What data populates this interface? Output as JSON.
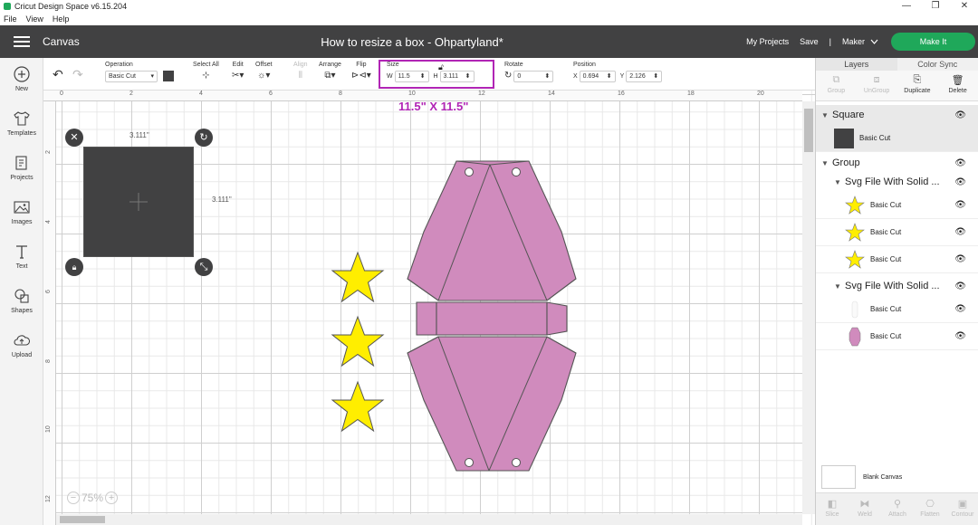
{
  "os": {
    "title": "Cricut Design Space  v6.15.204",
    "minimize": "—",
    "maximize": "❐",
    "close": "✕",
    "menu": [
      "File",
      "View",
      "Help"
    ]
  },
  "header": {
    "section": "Canvas",
    "doc_title": "How to resize a box - Ohpartyland*",
    "my_projects": "My Projects",
    "save": "Save",
    "separator": "|",
    "machine": "Maker",
    "make_it": "Make It"
  },
  "sidebar": {
    "items": [
      {
        "label": "New",
        "icon": "plus-circle-icon"
      },
      {
        "label": "Templates",
        "icon": "tshirt-icon"
      },
      {
        "label": "Projects",
        "icon": "projects-icon"
      },
      {
        "label": "Images",
        "icon": "images-icon"
      },
      {
        "label": "Text",
        "icon": "text-icon"
      },
      {
        "label": "Shapes",
        "icon": "shapes-icon"
      },
      {
        "label": "Upload",
        "icon": "upload-cloud-icon"
      }
    ]
  },
  "toolbar": {
    "operation_label": "Operation",
    "operation_value": "Basic Cut",
    "operation_color": "#414142",
    "select_all": "Select All",
    "edit": "Edit",
    "offset": "Offset",
    "align": "Align",
    "arrange": "Arrange",
    "flip": "Flip",
    "size_label": "Size",
    "w_label": "W",
    "w_value": "11.5",
    "h_label": "H",
    "h_value": "3.111",
    "rotate_label": "Rotate",
    "rotate_value": "0",
    "position_label": "Position",
    "x_label": "X",
    "x_value": "0.694",
    "y_label": "Y",
    "y_value": "2.126"
  },
  "annotation": "11.5\" X 11.5\"",
  "canvas": {
    "ruler_top": [
      "0",
      "2",
      "4",
      "6",
      "8",
      "10",
      "12",
      "14",
      "16",
      "18",
      "20"
    ],
    "ruler_left": [
      "2",
      "4",
      "6",
      "8",
      "10",
      "12"
    ],
    "square_width_label": "3.111\"",
    "square_height_label": "3.111\"",
    "zoom": "75%",
    "zoom_out": "−",
    "zoom_in": "+",
    "square_color": "#414142",
    "box_color": "#d08bbd",
    "star_color": "#ffee00"
  },
  "layers": {
    "tab_layers": "Layers",
    "tab_color_sync": "Color Sync",
    "actions": {
      "group": "Group",
      "ungroup": "UnGroup",
      "duplicate": "Duplicate",
      "delete": "Delete"
    },
    "square_header": "Square",
    "square_item": "Basic Cut",
    "group_header": "Group",
    "svg1_header": "Svg File With Solid ...",
    "svg1_items": [
      "Basic Cut",
      "Basic Cut",
      "Basic Cut"
    ],
    "svg2_header": "Svg File With Solid ...",
    "svg2_items": [
      "Basic Cut",
      "Basic Cut"
    ],
    "blank_canvas": "Blank Canvas",
    "bottom": {
      "slice": "Slice",
      "weld": "Weld",
      "attach": "Attach",
      "flatten": "Flatten",
      "contour": "Contour"
    }
  }
}
